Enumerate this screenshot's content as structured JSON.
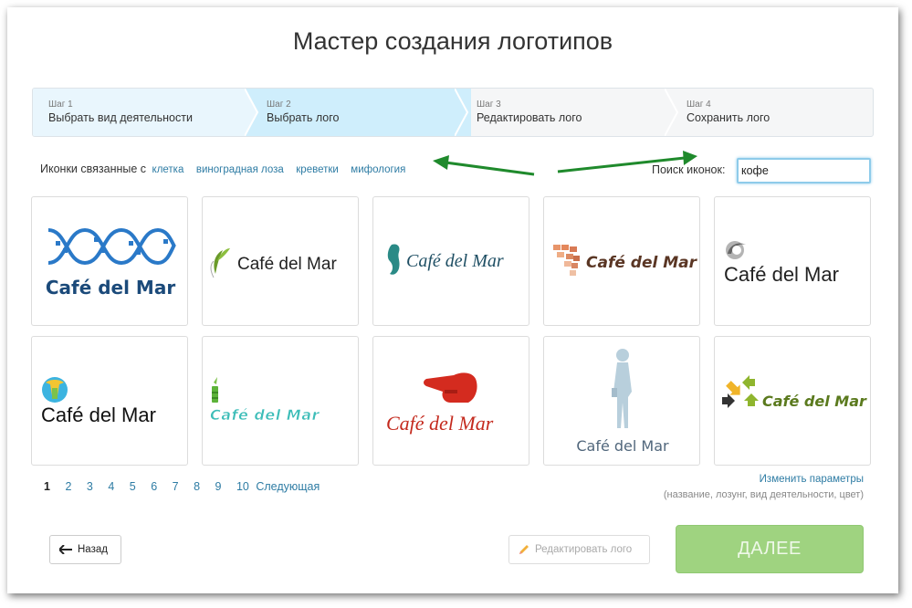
{
  "title": "Мастер создания логотипов",
  "steps": [
    {
      "num": "Шаг 1",
      "label": "Выбрать вид деятельности"
    },
    {
      "num": "Шаг 2",
      "label": "Выбрать лого"
    },
    {
      "num": "Шаг 3",
      "label": "Редактировать лого"
    },
    {
      "num": "Шаг 4",
      "label": "Сохранить лого"
    }
  ],
  "related": {
    "label": "Иконки связанные с",
    "tags": [
      "клетка",
      "виноградная лоза",
      "креветки",
      "мифология"
    ]
  },
  "search": {
    "label": "Поиск иконок:",
    "value": "кофе"
  },
  "logos": [
    {
      "text": "Café del Mar",
      "icon": "dna-helix-icon",
      "color": "#1b4a7a"
    },
    {
      "text": "Café del Mar",
      "icon": "leaf-sprout-icon",
      "color": "#222222"
    },
    {
      "text": "Café del Mar",
      "icon": "seahorse-icon",
      "color": "#1f4f64"
    },
    {
      "text": "Café del Mar",
      "icon": "fan-tiles-icon",
      "color": "#5a3624"
    },
    {
      "text": "Café del Mar",
      "icon": "swirl-globe-icon",
      "color": "#222222"
    },
    {
      "text": "Café del Mar",
      "icon": "globe-icon",
      "color": "#111111"
    },
    {
      "text": "Café del Mar",
      "icon": "bamboo-icon",
      "color": "#3dbdb8"
    },
    {
      "text": "Café del Mar",
      "icon": "pointing-hand-icon",
      "color": "#c42a1e"
    },
    {
      "text": "Café del Mar",
      "icon": "woman-silhouette-icon",
      "color": "#51677c"
    },
    {
      "text": "Café del Mar",
      "icon": "arrows-cross-icon",
      "color": "#5b7a1e"
    }
  ],
  "pagination": {
    "pages": [
      "1",
      "2",
      "3",
      "4",
      "5",
      "6",
      "7",
      "8",
      "9",
      "10"
    ],
    "current": "1",
    "next": "Следующая"
  },
  "change_params": {
    "link": "Изменить параметры",
    "hint": "(название, лозунг, вид деятельности, цвет)"
  },
  "buttons": {
    "back": "Назад",
    "edit": "Редактировать лого",
    "next": "ДАЛЕЕ"
  },
  "colors": {
    "link": "#2e7ca4",
    "step_active": "#cfeefc",
    "next_button": "#9fd380",
    "annotation_arrow": "#1f8a2c"
  }
}
